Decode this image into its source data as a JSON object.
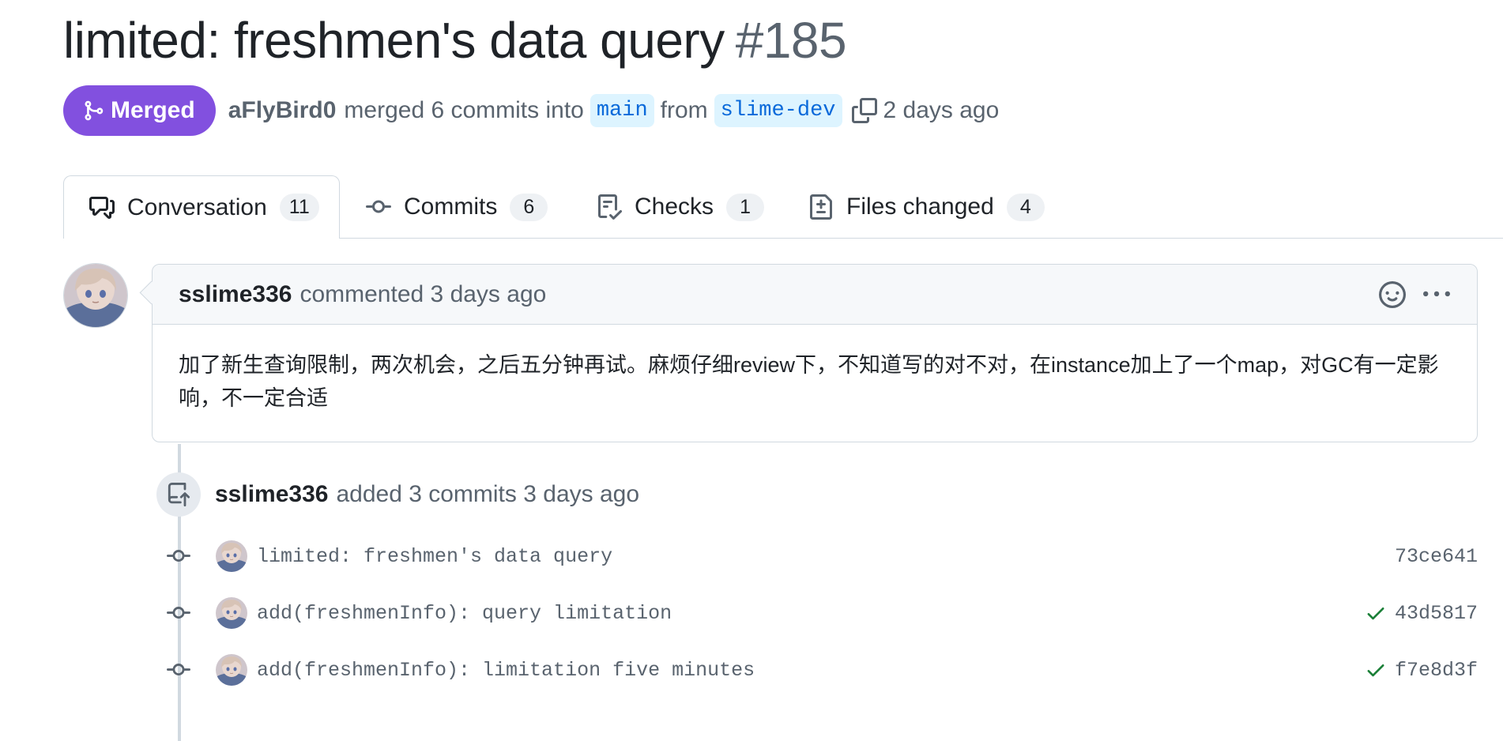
{
  "pr": {
    "title": "limited: freshmen's data query",
    "number": "#185",
    "state_label": "Merged",
    "author": "aFlyBird0",
    "merged_text": "merged 6 commits into",
    "base_branch": "main",
    "from_text": "from",
    "head_branch": "slime-dev",
    "time_ago": "2 days ago"
  },
  "tabs": [
    {
      "label": "Conversation",
      "count": "11",
      "icon": "comment-discussion-icon"
    },
    {
      "label": "Commits",
      "count": "6",
      "icon": "git-commit-icon"
    },
    {
      "label": "Checks",
      "count": "1",
      "icon": "checklist-icon"
    },
    {
      "label": "Files changed",
      "count": "4",
      "icon": "file-diff-icon"
    }
  ],
  "comment": {
    "author": "sslime336",
    "action_text": "commented",
    "time_ago": "3 days ago",
    "body": "加了新生查询限制，两次机会，之后五分钟再试。麻烦仔细review下，不知道写的对不对，在instance加上了一个map，对GC有一定影响，不一定合适"
  },
  "event": {
    "author": "sslime336",
    "text": "added 3 commits",
    "time_ago": "3 days ago"
  },
  "commits": [
    {
      "message": "limited: freshmen's data query",
      "sha": "73ce641",
      "check": false
    },
    {
      "message": "add(freshmenInfo): query limitation",
      "sha": "43d5817",
      "check": true
    },
    {
      "message": "add(freshmenInfo): limitation five minutes",
      "sha": "f7e8d3f",
      "check": true
    }
  ],
  "colors": {
    "merged": "#8250df",
    "branch_bg": "#ddf4ff",
    "branch_text": "#0969da",
    "check": "#1a7f37"
  }
}
